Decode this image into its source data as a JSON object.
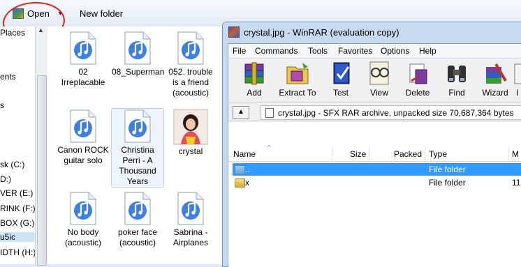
{
  "explorer": {
    "toolbar": {
      "open_label": "Open",
      "new_folder_label": "New folder"
    },
    "nav_items": [
      "Places",
      "ents",
      "s",
      "sk (C:)",
      "D:)",
      "VER (E:)",
      "RINK (F:)",
      "BOX (G:)",
      "u5ic",
      "IDTH (H:)"
    ],
    "files": [
      {
        "name": "02 Irreplacable",
        "type": "music"
      },
      {
        "name": "08_Superman",
        "type": "music"
      },
      {
        "name": "052. trouble is a friend (acoustic)",
        "type": "music"
      },
      {
        "name": "Canon ROCK guitar solo",
        "type": "music"
      },
      {
        "name": "Christina Perri - A Thousand Years",
        "type": "music"
      },
      {
        "name": "crystal",
        "type": "image"
      },
      {
        "name": "No body (acoustic)",
        "type": "music"
      },
      {
        "name": "poker face (acoustic)",
        "type": "music"
      },
      {
        "name": "Sabrina - Airplanes",
        "type": "music"
      }
    ]
  },
  "winrar": {
    "title": "crystal.jpg - WinRAR (evaluation copy)",
    "menu": [
      "File",
      "Commands",
      "Tools",
      "Favorites",
      "Options",
      "Help"
    ],
    "tools": [
      {
        "label": "Add",
        "icon": "add-archive-icon"
      },
      {
        "label": "Extract To",
        "icon": "extract-icon"
      },
      {
        "label": "Test",
        "icon": "test-icon"
      },
      {
        "label": "View",
        "icon": "view-icon"
      },
      {
        "label": "Delete",
        "icon": "delete-icon"
      },
      {
        "label": "Find",
        "icon": "find-icon"
      },
      {
        "label": "Wizard",
        "icon": "wizard-icon"
      },
      {
        "label": "I",
        "icon": "info-icon"
      }
    ],
    "path_text": "crystal.jpg - SFX RAR archive, unpacked size 70,687,364 bytes",
    "columns": [
      "Name",
      "Size",
      "Packed",
      "Type",
      "M"
    ],
    "rows": [
      {
        "name": "..",
        "size": "",
        "packed": "",
        "type": "File folder",
        "modified": "",
        "selected": true
      },
      {
        "name": "x",
        "size": "",
        "packed": "",
        "type": "File folder",
        "modified": "11,",
        "selected": false
      }
    ]
  }
}
